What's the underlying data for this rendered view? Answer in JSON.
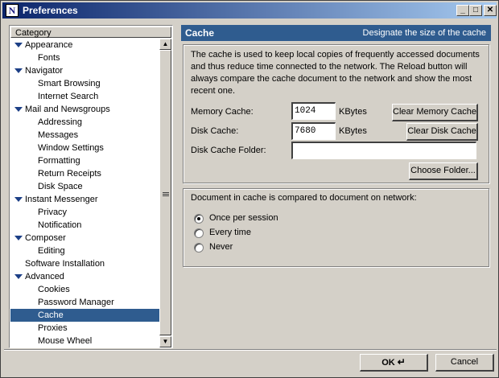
{
  "window": {
    "title": "Preferences",
    "icon_letter": "N"
  },
  "titlebar_buttons": {
    "minimize": "_",
    "maximize": "□",
    "close": "✕"
  },
  "category": {
    "header": "Category",
    "items": [
      {
        "label": "Appearance",
        "level": "parent"
      },
      {
        "label": "Fonts",
        "level": "child"
      },
      {
        "label": "Navigator",
        "level": "parent"
      },
      {
        "label": "Smart Browsing",
        "level": "child"
      },
      {
        "label": "Internet Search",
        "level": "child"
      },
      {
        "label": "Mail and Newsgroups",
        "level": "parent"
      },
      {
        "label": "Addressing",
        "level": "child"
      },
      {
        "label": "Messages",
        "level": "child"
      },
      {
        "label": "Window Settings",
        "level": "child"
      },
      {
        "label": "Formatting",
        "level": "child"
      },
      {
        "label": "Return Receipts",
        "level": "child"
      },
      {
        "label": "Disk Space",
        "level": "child"
      },
      {
        "label": "Instant Messenger",
        "level": "parent"
      },
      {
        "label": "Privacy",
        "level": "child"
      },
      {
        "label": "Notification",
        "level": "child"
      },
      {
        "label": "Composer",
        "level": "parent"
      },
      {
        "label": "Editing",
        "level": "child"
      },
      {
        "label": "Software Installation",
        "level": "root"
      },
      {
        "label": "Advanced",
        "level": "parent"
      },
      {
        "label": "Cookies",
        "level": "child"
      },
      {
        "label": "Password Manager",
        "level": "child"
      },
      {
        "label": "Cache",
        "level": "child",
        "selected": true
      },
      {
        "label": "Proxies",
        "level": "child"
      },
      {
        "label": "Mouse Wheel",
        "level": "child"
      }
    ]
  },
  "panel": {
    "title": "Cache",
    "subtitle": "Designate the size of the cache",
    "description": "The cache is used to keep local copies of frequently accessed documents and thus reduce time connected to the network. The Reload button will always compare the cache document to the network and show the most recent one.",
    "memory_cache": {
      "label": "Memory Cache:",
      "value": "1024",
      "unit": "KBytes",
      "button": "Clear Memory Cache"
    },
    "disk_cache": {
      "label": "Disk Cache:",
      "value": "7680",
      "unit": "KBytes",
      "button": "Clear Disk Cache"
    },
    "disk_folder": {
      "label": "Disk Cache Folder:",
      "value": "",
      "button": "Choose Folder..."
    },
    "compare": {
      "label": "Document in cache is compared to document on network:",
      "options": [
        {
          "label": "Once per session",
          "selected": true
        },
        {
          "label": "Every time",
          "selected": false
        },
        {
          "label": "Never",
          "selected": false
        }
      ]
    }
  },
  "footer": {
    "ok": "OK",
    "cancel": "Cancel"
  },
  "colors": {
    "selection": "#2f5c8f",
    "header_bg": "#2f5c8f",
    "twisty": "#1c3f86"
  }
}
